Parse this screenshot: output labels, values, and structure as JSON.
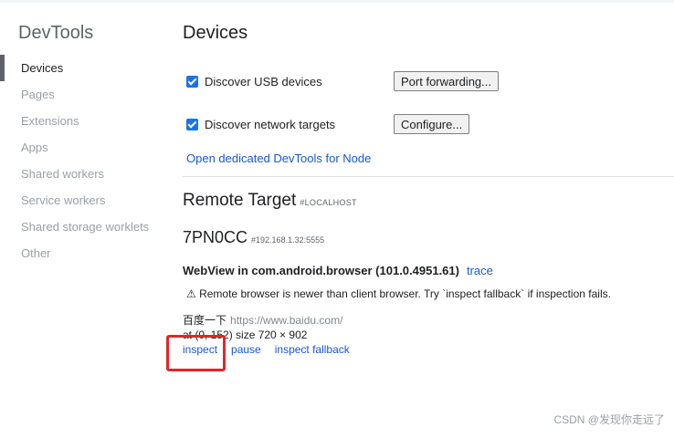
{
  "sidebar": {
    "title": "DevTools",
    "items": [
      {
        "label": "Devices"
      },
      {
        "label": "Pages"
      },
      {
        "label": "Extensions"
      },
      {
        "label": "Apps"
      },
      {
        "label": "Shared workers"
      },
      {
        "label": "Service workers"
      },
      {
        "label": "Shared storage worklets"
      },
      {
        "label": "Other"
      }
    ]
  },
  "main": {
    "title": "Devices",
    "discover_usb": {
      "label": "Discover USB devices",
      "checked": true,
      "button": "Port forwarding..."
    },
    "discover_network": {
      "label": "Discover network targets",
      "checked": true,
      "button": "Configure..."
    },
    "node_link": "Open dedicated DevTools for Node",
    "remote_target": {
      "title": "Remote Target",
      "tag": "#LOCALHOST"
    },
    "device": {
      "name": "7PN0CC",
      "address": "#192.168.1.32:5555",
      "browser": "WebView in com.android.browser (101.0.4951.61)",
      "trace": "trace",
      "warning": "⚠ Remote browser is newer than client browser. Try `inspect fallback` if inspection fails.",
      "page_title": "百度一下",
      "page_url": "https://www.baidu.com/",
      "position": "at (0, 152)  size 720 × 902",
      "actions": {
        "inspect": "inspect",
        "pause": "pause",
        "inspect_fallback": "inspect fallback"
      }
    }
  },
  "watermark": "CSDN @发现你走远了",
  "colors": {
    "accent": "#1a73e8",
    "link": "#1558d6",
    "highlight": "#e0272b"
  }
}
